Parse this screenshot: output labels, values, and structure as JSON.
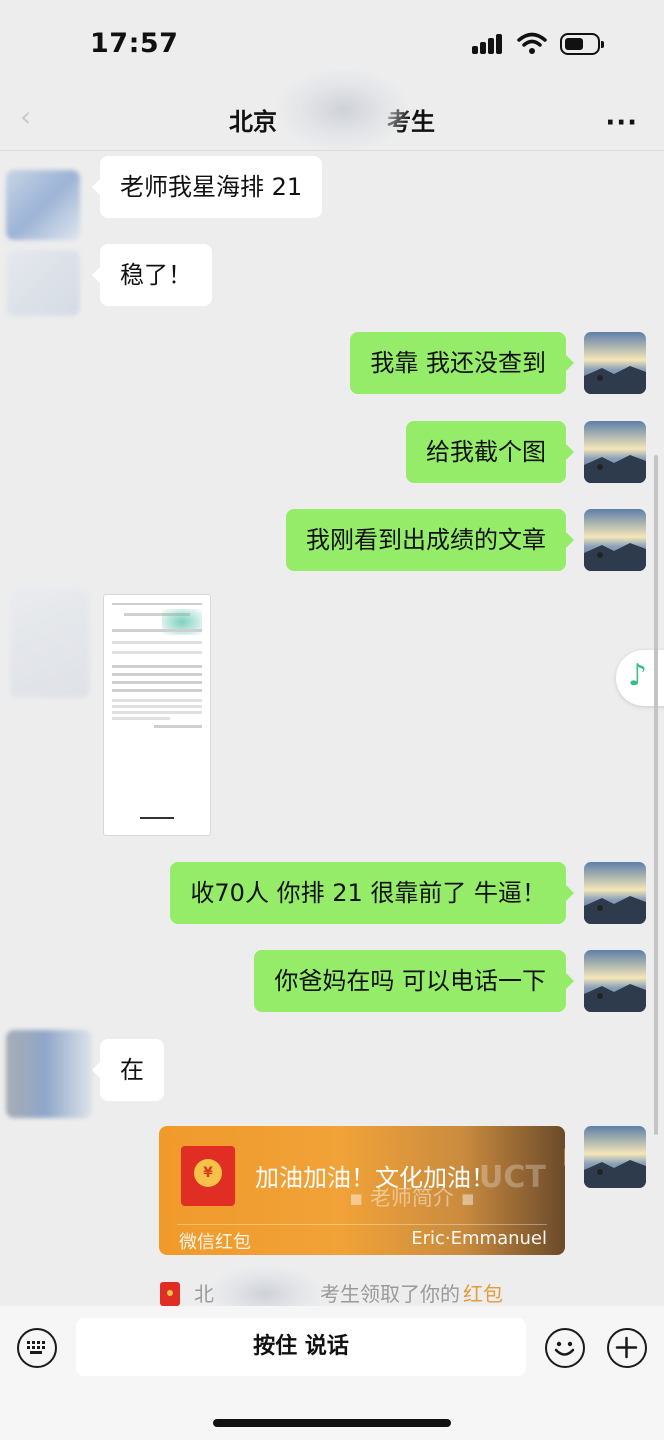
{
  "status": {
    "time": "17:57"
  },
  "nav": {
    "back_glyph": "‹",
    "title_left": "北京",
    "title_right": "考生",
    "more_glyph": "···"
  },
  "messages": [
    {
      "side": "in",
      "text": "老师我星海排 21"
    },
    {
      "side": "in",
      "text": "稳了！"
    },
    {
      "side": "out",
      "text": "我靠 我还没查到"
    },
    {
      "side": "out",
      "text": "给我截个图"
    },
    {
      "side": "out",
      "text": "我刚看到出成绩的文章"
    },
    {
      "side": "in",
      "type": "image"
    },
    {
      "side": "out",
      "text": "收70人 你排 21 很靠前了 牛逼！"
    },
    {
      "side": "out",
      "text": "你爸妈在吗 可以电话一下"
    },
    {
      "side": "in",
      "text": "在"
    }
  ],
  "red_packet": {
    "message": "加油加油！文化加油！",
    "overlay_text": "▪ 老师简介 ▪",
    "overlay_text2": "UCT",
    "label": "微信红包",
    "sender": "Eric·Emmanuel",
    "icon_glyph": "¥"
  },
  "system_notice": {
    "prefix": "北",
    "suffix": "考生领取了你的",
    "link": "红包"
  },
  "input_bar": {
    "talk_label": "按住 说话"
  },
  "music_glyph": "♪",
  "icons": {
    "back": "back-icon",
    "more": "more-icon",
    "keyboard": "keyboard-icon",
    "emoji": "emoji-icon",
    "plus": "plus-icon",
    "music": "music-note-icon",
    "red_packet": "red-packet-icon"
  },
  "colors": {
    "outgoing_bubble": "#95ec69",
    "incoming_bubble": "#ffffff",
    "background": "#ededed",
    "red_packet": "#f09a2b",
    "link": "#e19d3c"
  }
}
